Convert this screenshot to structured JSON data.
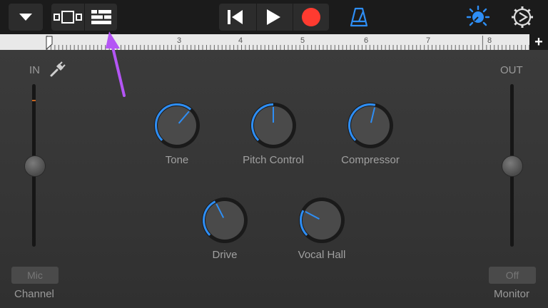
{
  "toolbar": {
    "icons": [
      "dropdown-arrow-icon",
      "view-toggle-icon",
      "tracks-view-icon",
      "rewind-icon",
      "play-icon",
      "record-icon",
      "metronome-icon",
      "master-volume-icon",
      "settings-icon"
    ],
    "record_color": "#ff3b30",
    "accent_color": "#2e8ef5",
    "annotation_arrow_color": "#b455f5"
  },
  "ruler": {
    "markers": [
      "3",
      "4",
      "5",
      "6",
      "7",
      "8"
    ],
    "add_label": "+"
  },
  "input": {
    "label": "IN",
    "input_level": 0.5,
    "mic_button": "Mic",
    "channel_label": "Channel"
  },
  "output": {
    "label": "OUT",
    "output_level": 0.5,
    "off_button": "Off",
    "monitor_label": "Monitor"
  },
  "knobs": [
    {
      "label": "Tone",
      "value": 0.65
    },
    {
      "label": "Pitch Control",
      "value": 0.5
    },
    {
      "label": "Compressor",
      "value": 0.55
    },
    {
      "label": "Drive",
      "value": 0.4
    },
    {
      "label": "Vocal Hall",
      "value": 0.27
    }
  ]
}
